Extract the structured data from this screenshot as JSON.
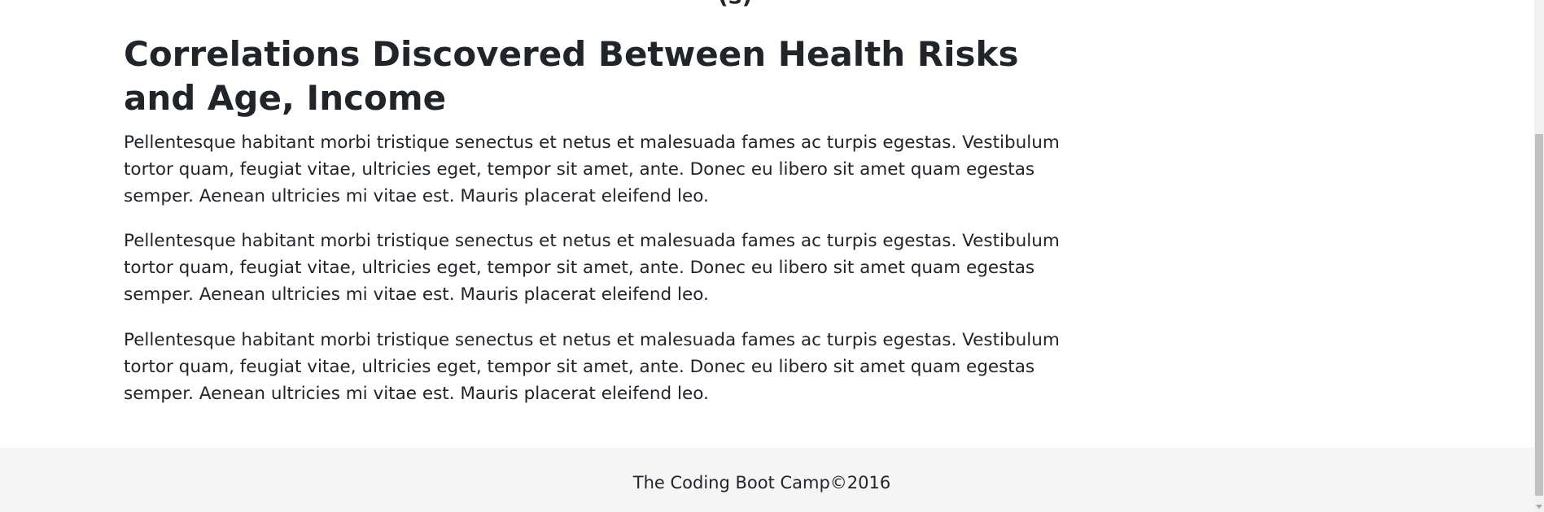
{
  "article": {
    "clipped_heading": "(s)",
    "title": "Correlations Discovered Between Health Risks and Age, Income",
    "paragraphs": [
      "Pellentesque habitant morbi tristique senectus et netus et malesuada fames ac turpis egestas. Vestibulum tortor quam, feugiat vitae, ultricies eget, tempor sit amet, ante. Donec eu libero sit amet quam egestas semper. Aenean ultricies mi vitae est. Mauris placerat eleifend leo.",
      "Pellentesque habitant morbi tristique senectus et netus et malesuada fames ac turpis egestas. Vestibulum tortor quam, feugiat vitae, ultricies eget, tempor sit amet, ante. Donec eu libero sit amet quam egestas semper. Aenean ultricies mi vitae est. Mauris placerat eleifend leo.",
      "Pellentesque habitant morbi tristique senectus et netus et malesuada fames ac turpis egestas. Vestibulum tortor quam, feugiat vitae, ultricies eget, tempor sit amet, ante. Donec eu libero sit amet quam egestas semper. Aenean ultricies mi vitae est. Mauris placerat eleifend leo."
    ]
  },
  "footer": {
    "text": "The Coding Boot Camp©2016"
  },
  "colors": {
    "text": "#212529",
    "footer_bg": "#f5f5f5",
    "scroll_thumb": "#c1c1c1"
  }
}
